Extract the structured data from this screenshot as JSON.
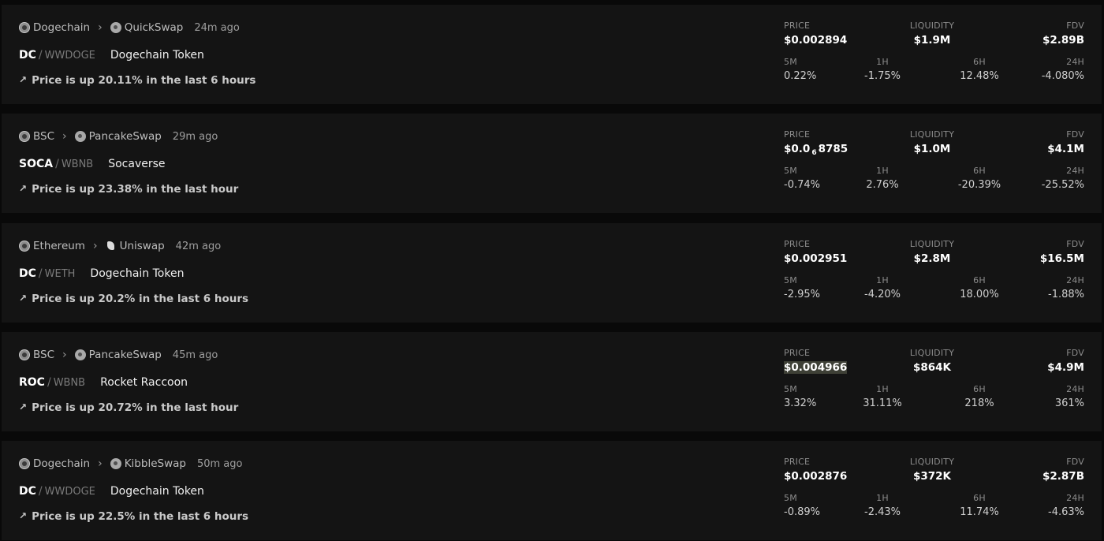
{
  "pairs": [
    {
      "chain": "Dogechain",
      "dex": "QuickSwap",
      "age": "24m ago",
      "base": "DC",
      "quote": "WWDOGE",
      "name": "Dogechain Token",
      "trend": "Price is up 20.11% in the last 6 hours",
      "price_label": "PRICE",
      "price": "$0.002894",
      "liquidity_label": "LIQUIDITY",
      "liquidity": "$1.9M",
      "fdv_label": "FDV",
      "fdv": "$2.89B",
      "m5_label": "5M",
      "m5": "0.22%",
      "h1_label": "1H",
      "h1": "-1.75%",
      "h6_label": "6H",
      "h6": "12.48%",
      "h24_label": "24H",
      "h24": "-4.080%"
    },
    {
      "chain": "BSC",
      "dex": "PancakeSwap",
      "age": "29m ago",
      "base": "SOCA",
      "quote": "WBNB",
      "name": "Socaverse",
      "trend": "Price is up 23.38% in the last hour",
      "price_label": "PRICE",
      "price_prefix": "$0.0",
      "price_sub": "6",
      "price_suffix": "8785",
      "liquidity_label": "LIQUIDITY",
      "liquidity": "$1.0M",
      "fdv_label": "FDV",
      "fdv": "$4.1M",
      "m5_label": "5M",
      "m5": "-0.74%",
      "h1_label": "1H",
      "h1": "2.76%",
      "h6_label": "6H",
      "h6": "-20.39%",
      "h24_label": "24H",
      "h24": "-25.52%"
    },
    {
      "chain": "Ethereum",
      "dex": "Uniswap",
      "age": "42m ago",
      "base": "DC",
      "quote": "WETH",
      "name": "Dogechain Token",
      "trend": "Price is up 20.2% in the last 6 hours",
      "price_label": "PRICE",
      "price": "$0.002951",
      "liquidity_label": "LIQUIDITY",
      "liquidity": "$2.8M",
      "fdv_label": "FDV",
      "fdv": "$16.5M",
      "m5_label": "5M",
      "m5": "-2.95%",
      "h1_label": "1H",
      "h1": "-4.20%",
      "h6_label": "6H",
      "h6": "18.00%",
      "h24_label": "24H",
      "h24": "-1.88%"
    },
    {
      "chain": "BSC",
      "dex": "PancakeSwap",
      "age": "45m ago",
      "base": "ROC",
      "quote": "WBNB",
      "name": "Rocket Raccoon",
      "trend": "Price is up 20.72% in the last hour",
      "price_label": "PRICE",
      "price": "$0.004966",
      "liquidity_label": "LIQUIDITY",
      "liquidity": "$864K",
      "fdv_label": "FDV",
      "fdv": "$4.9M",
      "m5_label": "5M",
      "m5": "3.32%",
      "h1_label": "1H",
      "h1": "31.11%",
      "h6_label": "6H",
      "h6": "218%",
      "h24_label": "24H",
      "h24": "361%"
    },
    {
      "chain": "Dogechain",
      "dex": "KibbleSwap",
      "age": "50m ago",
      "base": "DC",
      "quote": "WWDOGE",
      "name": "Dogechain Token",
      "trend": "Price is up 22.5% in the last 6 hours",
      "price_label": "PRICE",
      "price": "$0.002876",
      "liquidity_label": "LIQUIDITY",
      "liquidity": "$372K",
      "fdv_label": "FDV",
      "fdv": "$2.87B",
      "m5_label": "5M",
      "m5": "-0.89%",
      "h1_label": "1H",
      "h1": "-2.43%",
      "h6_label": "6H",
      "h6": "11.74%",
      "h24_label": "24H",
      "h24": "-4.63%"
    }
  ],
  "colors": {
    "background": "#090909",
    "card": "#141414",
    "text": "#ffffff",
    "muted": "#8c8c8c"
  },
  "icons": {
    "trend": "trending-up-icon",
    "separator": "chevron-right-icon"
  }
}
